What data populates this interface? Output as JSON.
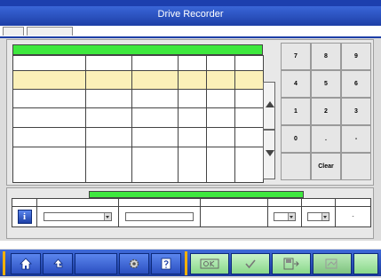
{
  "window": {
    "title": ""
  },
  "header": {
    "title": "Drive Recorder",
    "right_label": ""
  },
  "tabs": [
    {
      "label": ""
    },
    {
      "label": ""
    },
    {
      "label": ""
    }
  ],
  "settings": {
    "title": "",
    "columns": [
      "",
      "",
      "",
      "",
      "",
      ""
    ],
    "rows": [
      [
        "",
        "",
        "",
        "",
        "",
        ""
      ],
      [
        "",
        "",
        "",
        "",
        "",
        ""
      ],
      [
        "",
        "",
        "",
        "",
        "",
        ""
      ],
      [
        "",
        "",
        "",
        "",
        "",
        ""
      ],
      [
        "",
        "",
        "",
        "",
        "",
        ""
      ]
    ]
  },
  "keypad": {
    "rows": [
      [
        "7",
        "8",
        "9"
      ],
      [
        "4",
        "5",
        "6"
      ],
      [
        "1",
        "2",
        "3"
      ],
      [
        "0",
        ".",
        "-"
      ]
    ],
    "delete_label": "",
    "clear_label": "Clear"
  },
  "lower": {
    "title": "",
    "columns": [
      "",
      "",
      "",
      "",
      "",
      "",
      ""
    ],
    "row": {
      "info_icon": "i",
      "item_value": "",
      "threshold_value": "",
      "unit": "",
      "condition_value": "",
      "storage_value": "",
      "last": "-"
    }
  },
  "status": {
    "text": ""
  },
  "toolbar": {
    "icons": [
      "home-icon",
      "back-icon",
      "settings-icon",
      "help-icon",
      "ok-icon",
      "check-icon",
      "save-icon",
      "export-icon"
    ],
    "accent": "#1d3fa6",
    "separator_color": "#f2b000"
  }
}
